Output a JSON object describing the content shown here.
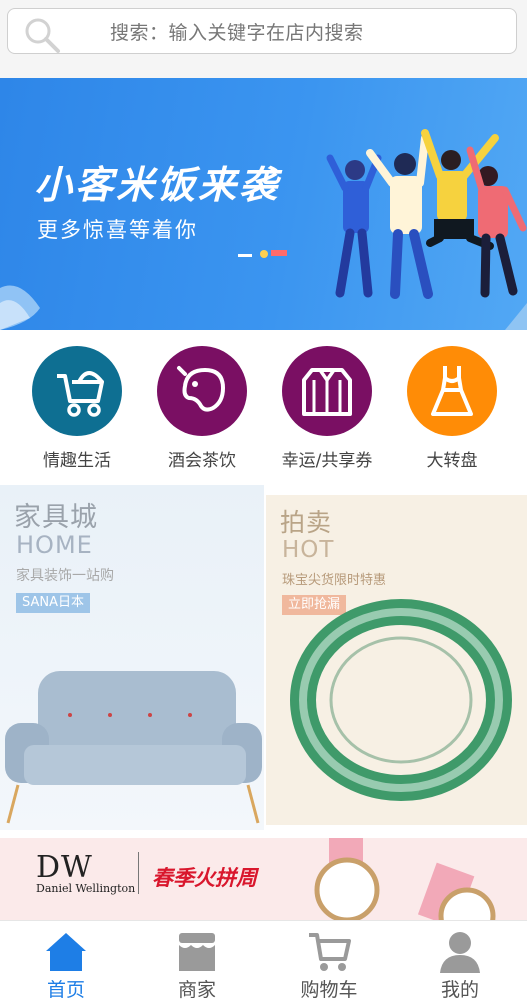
{
  "search": {
    "placeholder_text": "搜索：输入关键字在店内搜索"
  },
  "banner": {
    "title": "小客米饭来袭",
    "subtitle": "更多惊喜等着你"
  },
  "categories": [
    {
      "label": "情趣生活",
      "icon": "baby-stroller-icon",
      "color": "#0e6f92"
    },
    {
      "label": "酒会茶饮",
      "icon": "teapot-icon",
      "color": "#7a0f63"
    },
    {
      "label": "幸运/共享券",
      "icon": "shirt-icon",
      "color": "#7a0f63"
    },
    {
      "label": "大转盘",
      "icon": "dress-icon",
      "color": "#ff8c06"
    }
  ],
  "promos": {
    "furniture": {
      "title": "家具城",
      "en": "HOME",
      "desc": "家具装饰一站购",
      "tag": "SANA日本"
    },
    "auction": {
      "title": "拍卖",
      "en": "HOT",
      "desc": "珠宝尖货限时特惠",
      "tag": "立即抢漏"
    }
  },
  "ad": {
    "brand": "DW",
    "brand_full": "Daniel Wellington",
    "slogan": "春季火拼周"
  },
  "tabbar": {
    "items": [
      {
        "label": "首页",
        "icon": "home-icon"
      },
      {
        "label": "商家",
        "icon": "store-icon"
      },
      {
        "label": "购物车",
        "icon": "cart-icon"
      },
      {
        "label": "我的",
        "icon": "user-icon"
      }
    ],
    "active_color": "#1e7ee6",
    "inactive_color": "#9a9a9a"
  }
}
